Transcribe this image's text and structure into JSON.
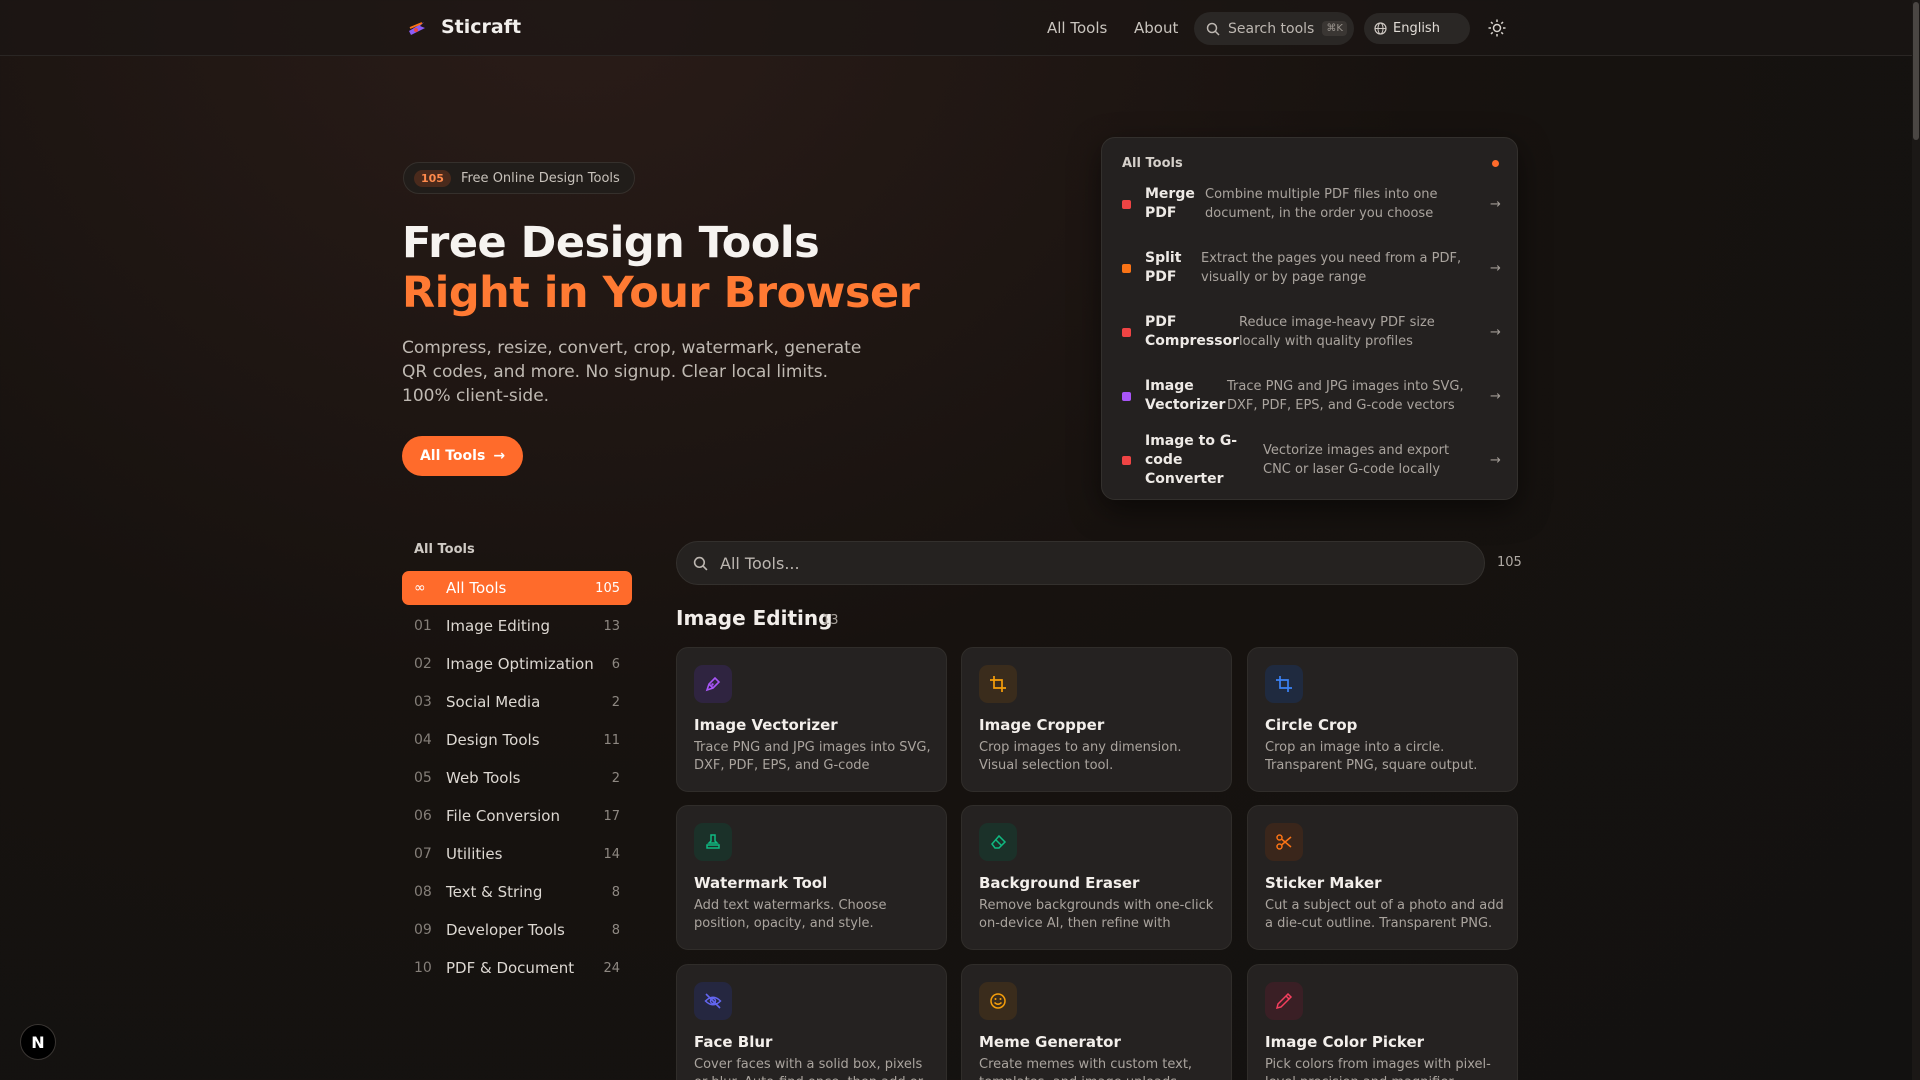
{
  "header": {
    "brand": "Sticraft",
    "nav": [
      "All Tools",
      "About"
    ],
    "search_placeholder": "Search tools",
    "search_shortcut": "⌘K",
    "language": "English"
  },
  "hero": {
    "badge_count": "105",
    "badge_text": "Free Online Design Tools",
    "title_line1": "Free Design Tools",
    "title_line2": "Right in Your Browser",
    "description": "Compress, resize, convert, crop, watermark, generate QR codes, and more. No signup. Clear local limits. 100% client-side.",
    "cta_label": "All Tools"
  },
  "featured": {
    "title": "All Tools",
    "items": [
      {
        "name": "Merge PDF",
        "desc": "Combine multiple PDF files into one document, in the order you choose",
        "color": "#ef4444"
      },
      {
        "name": "Split PDF",
        "desc": "Extract the pages you need from a PDF, visually or by page range",
        "color": "#f97316"
      },
      {
        "name": "PDF Compressor",
        "desc": "Reduce image-heavy PDF size locally with quality profiles",
        "color": "#ef4444"
      },
      {
        "name": "Image Vectorizer",
        "desc": "Trace PNG and JPG images into SVG, DXF, PDF, EPS, and G-code vectors",
        "color": "#a855f7"
      },
      {
        "name": "Image to G-code Converter",
        "desc": "Vectorize images and export CNC or laser G-code locally",
        "color": "#ef4444"
      }
    ]
  },
  "sidebar": {
    "title": "All Tools",
    "items": [
      {
        "num": "∞",
        "label": "All Tools",
        "count": "105"
      },
      {
        "num": "01",
        "label": "Image Editing",
        "count": "13"
      },
      {
        "num": "02",
        "label": "Image Optimization",
        "count": "6"
      },
      {
        "num": "03",
        "label": "Social Media",
        "count": "2"
      },
      {
        "num": "04",
        "label": "Design Tools",
        "count": "11"
      },
      {
        "num": "05",
        "label": "Web Tools",
        "count": "2"
      },
      {
        "num": "06",
        "label": "File Conversion",
        "count": "17"
      },
      {
        "num": "07",
        "label": "Utilities",
        "count": "14"
      },
      {
        "num": "08",
        "label": "Text & String",
        "count": "8"
      },
      {
        "num": "09",
        "label": "Developer Tools",
        "count": "8"
      },
      {
        "num": "10",
        "label": "PDF & Document",
        "count": "24"
      }
    ]
  },
  "main": {
    "search_placeholder": "All Tools...",
    "total": "105",
    "section_title": "Image Editing",
    "section_count": "13",
    "cards": [
      {
        "title": "Image Vectorizer",
        "desc": "Trace PNG and JPG images into SVG, DXF, PDF, EPS, and G-code vectors....",
        "icon": "pen-tool-icon",
        "color": "#a855f7",
        "bg": "#2f2440"
      },
      {
        "title": "Image Cropper",
        "desc": "Crop images to any dimension. Visual selection tool.",
        "icon": "crop-icon",
        "color": "#f59e0b",
        "bg": "#3a2c1c"
      },
      {
        "title": "Circle Crop",
        "desc": "Crop an image into a circle. Transparent PNG, square output.",
        "icon": "crop-icon",
        "color": "#3b82f6",
        "bg": "#1f2a3f"
      },
      {
        "title": "Watermark Tool",
        "desc": "Add text watermarks. Choose position, opacity, and style.",
        "icon": "stamp-icon",
        "color": "#10b981",
        "bg": "#1b3129"
      },
      {
        "title": "Background Eraser",
        "desc": "Remove backgrounds with one-click on-device AI, then refine with magic...",
        "icon": "eraser-icon",
        "color": "#10b981",
        "bg": "#1b3129"
      },
      {
        "title": "Sticker Maker",
        "desc": "Cut a subject out of a photo and add a die-cut outline. Transparent PNG.",
        "icon": "scissors-icon",
        "color": "#f97316",
        "bg": "#3a261b"
      },
      {
        "title": "Face Blur",
        "desc": "Cover faces with a solid box, pixels or blur. Auto-find once, then add or edit...",
        "icon": "eye-off-icon",
        "color": "#6366f1",
        "bg": "#252740"
      },
      {
        "title": "Meme Generator",
        "desc": "Create memes with custom text, templates, and image uploads.",
        "icon": "smile-icon",
        "color": "#f59e0b",
        "bg": "#3a2c1c"
      },
      {
        "title": "Image Color Picker",
        "desc": "Pick colors from images with pixel-level precision and magnifier.",
        "icon": "pipette-icon",
        "color": "#f43f5e",
        "bg": "#3a1f25"
      }
    ]
  },
  "footer_badge": "N"
}
